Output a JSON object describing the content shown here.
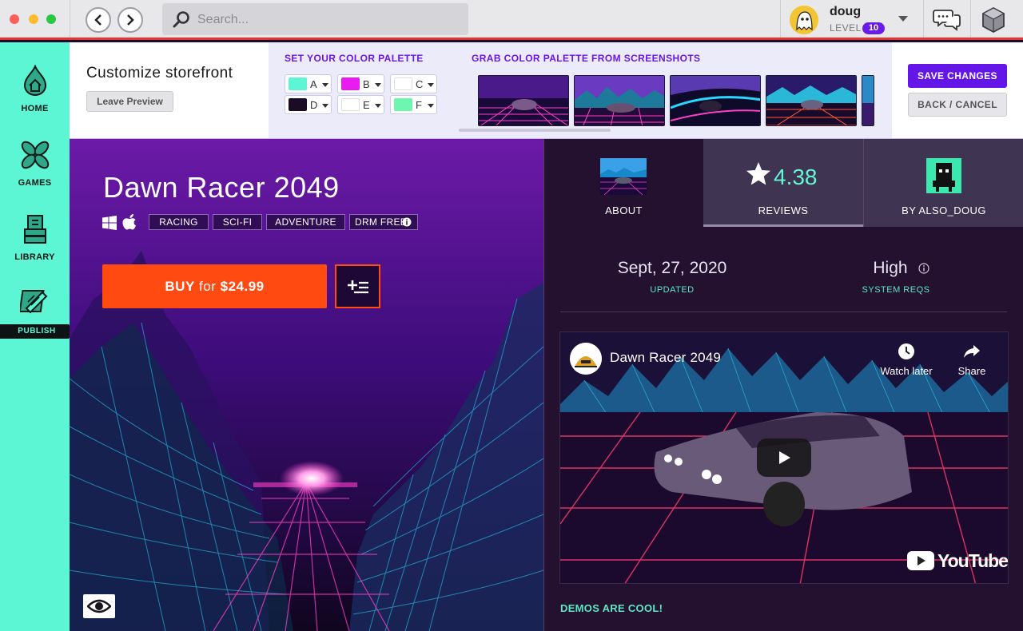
{
  "app": {
    "search_placeholder": "Search...",
    "user": {
      "name": "doug",
      "level_label": "LEVEL",
      "level": "10"
    }
  },
  "sidebar": {
    "items": [
      {
        "label": "HOME"
      },
      {
        "label": "GAMES"
      },
      {
        "label": "LIBRARY"
      },
      {
        "label": "PUBLISH"
      }
    ]
  },
  "customize": {
    "title": "Customize storefront",
    "leave_label": "Leave Preview",
    "palette_heading": "SET YOUR COLOR PALETTE",
    "screenshots_heading": "GRAB COLOR PALETTE FROM SCREENSHOTS",
    "swatches": [
      {
        "letter": "A",
        "color": "#5cf6d4"
      },
      {
        "letter": "B",
        "color": "#e81cf0"
      },
      {
        "letter": "C",
        "color": "#ffffff"
      },
      {
        "letter": "D",
        "color": "#1a0b26"
      },
      {
        "letter": "E",
        "color": "#ffffff"
      },
      {
        "letter": "F",
        "color": "#6ef5b0"
      }
    ],
    "save_label": "SAVE CHANGES",
    "cancel_label": "BACK / CANCEL"
  },
  "game": {
    "title": "Dawn Racer 2049",
    "tags": [
      "RACING",
      "SCI-FI",
      "ADVENTURE",
      "DRM FREE"
    ],
    "buy_prefix": "BUY",
    "buy_for": "for",
    "price": "$24.99"
  },
  "details": {
    "tabs": [
      {
        "label": "ABOUT"
      },
      {
        "label": "REVIEWS",
        "rating": "4.38"
      },
      {
        "label": "BY ALSO_DOUG"
      }
    ],
    "updated_value": "Sept, 27, 2020",
    "updated_label": "UPDATED",
    "sysreq_value": "High",
    "sysreq_label": "SYSTEM REQS",
    "video": {
      "title": "Dawn Racer 2049",
      "watch_later": "Watch later",
      "share": "Share",
      "brand": "YouTube"
    },
    "demos_label": "DEMOS ARE COOL!"
  },
  "colors": {
    "accent": "#6416e8",
    "mint": "#5cf6d4",
    "buy": "#ff4a12",
    "topbar_border": "#e8332b"
  }
}
